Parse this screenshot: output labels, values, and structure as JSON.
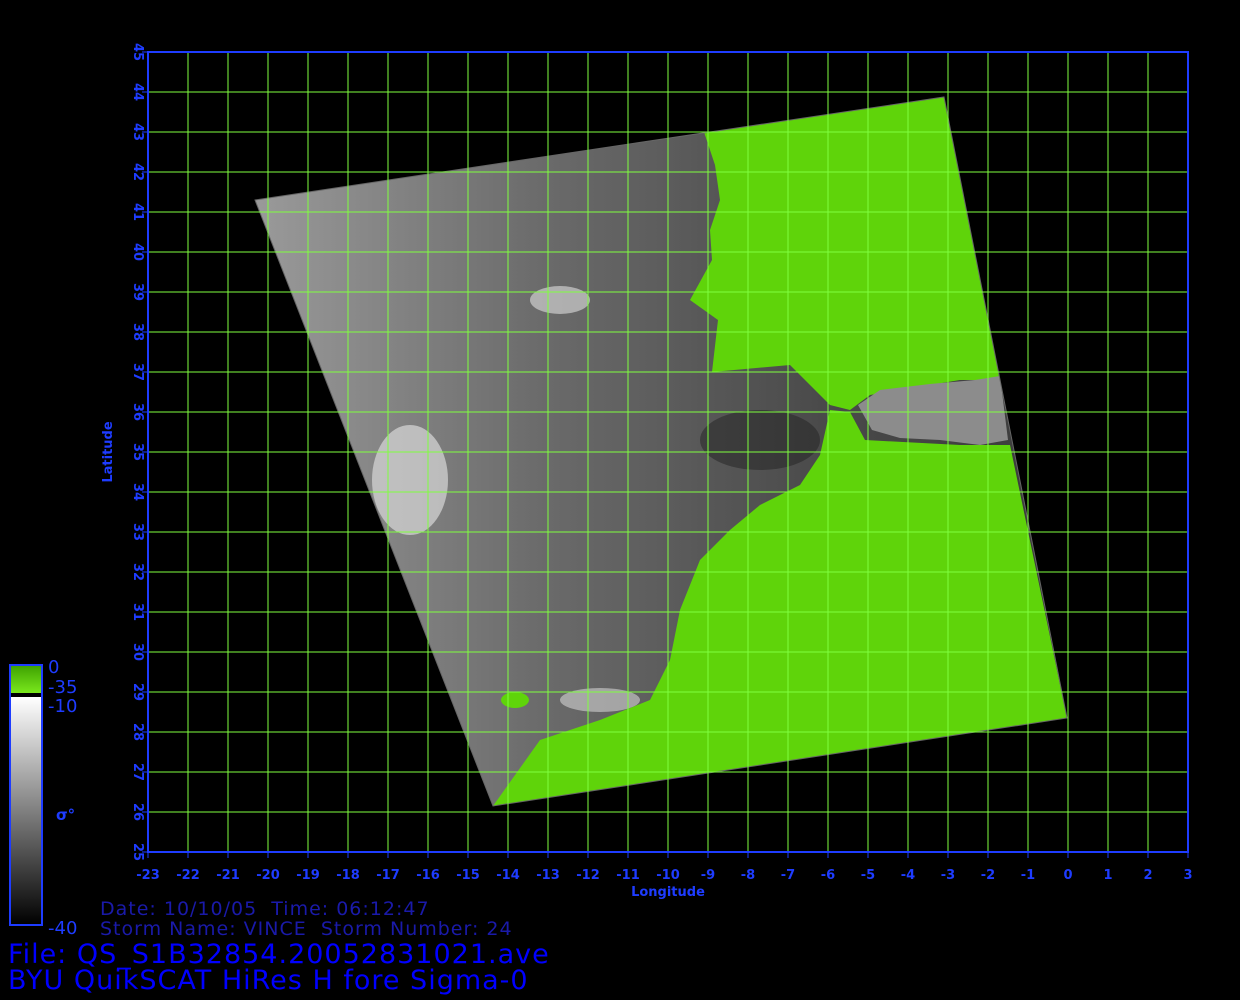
{
  "map": {
    "xaxis": {
      "label": "Longitude",
      "ticks": [
        "-23",
        "-22",
        "-21",
        "-20",
        "-19",
        "-18",
        "-17",
        "-16",
        "-15",
        "-14",
        "-13",
        "-12",
        "-11",
        "-10",
        "-9",
        "-8",
        "-7",
        "-6",
        "-5",
        "-4",
        "-3",
        "-2",
        "-1",
        "0",
        "1",
        "2",
        "3"
      ]
    },
    "yaxis": {
      "label": "Latitude",
      "ticks": [
        "25",
        "26",
        "27",
        "28",
        "29",
        "30",
        "31",
        "32",
        "33",
        "34",
        "35",
        "36",
        "37",
        "38",
        "39",
        "40",
        "41",
        "42",
        "43",
        "44",
        "45"
      ]
    },
    "colors": {
      "frame": "#1e3cff",
      "grid": "#7fff3f",
      "land": "#5fd40a",
      "tick_text": "#1e3cff"
    }
  },
  "colorbar": {
    "labels": {
      "top": "0",
      "land_low": "-35",
      "sea_high": "-10",
      "bottom": "-40"
    },
    "symbol": "σ°"
  },
  "info": {
    "date_line": "Date: 10/10/05  Time: 06:12:47",
    "storm_line": "Storm Name: VINCE  Storm Number: 24",
    "file_line": "File: QS_S1B32854.20052831021.ave",
    "product_line": "BYU QuikSCAT HiRes H fore Sigma-0"
  }
}
